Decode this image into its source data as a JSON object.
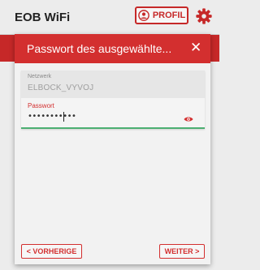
{
  "app": {
    "title": "EOB WiFi",
    "profile_label": "PROFIL"
  },
  "dialog": {
    "title": "Passwort des ausgewählte...",
    "close": "✕",
    "network": {
      "label": "Netzwerk",
      "value": "ELBOCK_VYVOJ"
    },
    "password": {
      "label": "Passwort",
      "value": "•••••••••••"
    },
    "prev_label": "< VORHERIGE",
    "next_label": "WEITER >"
  },
  "colors": {
    "accent": "#d32f2f",
    "focus_line": "#4caf72"
  },
  "icons": {
    "profile": "profile-icon",
    "settings": "gear-icon",
    "visibility": "eye-icon"
  }
}
